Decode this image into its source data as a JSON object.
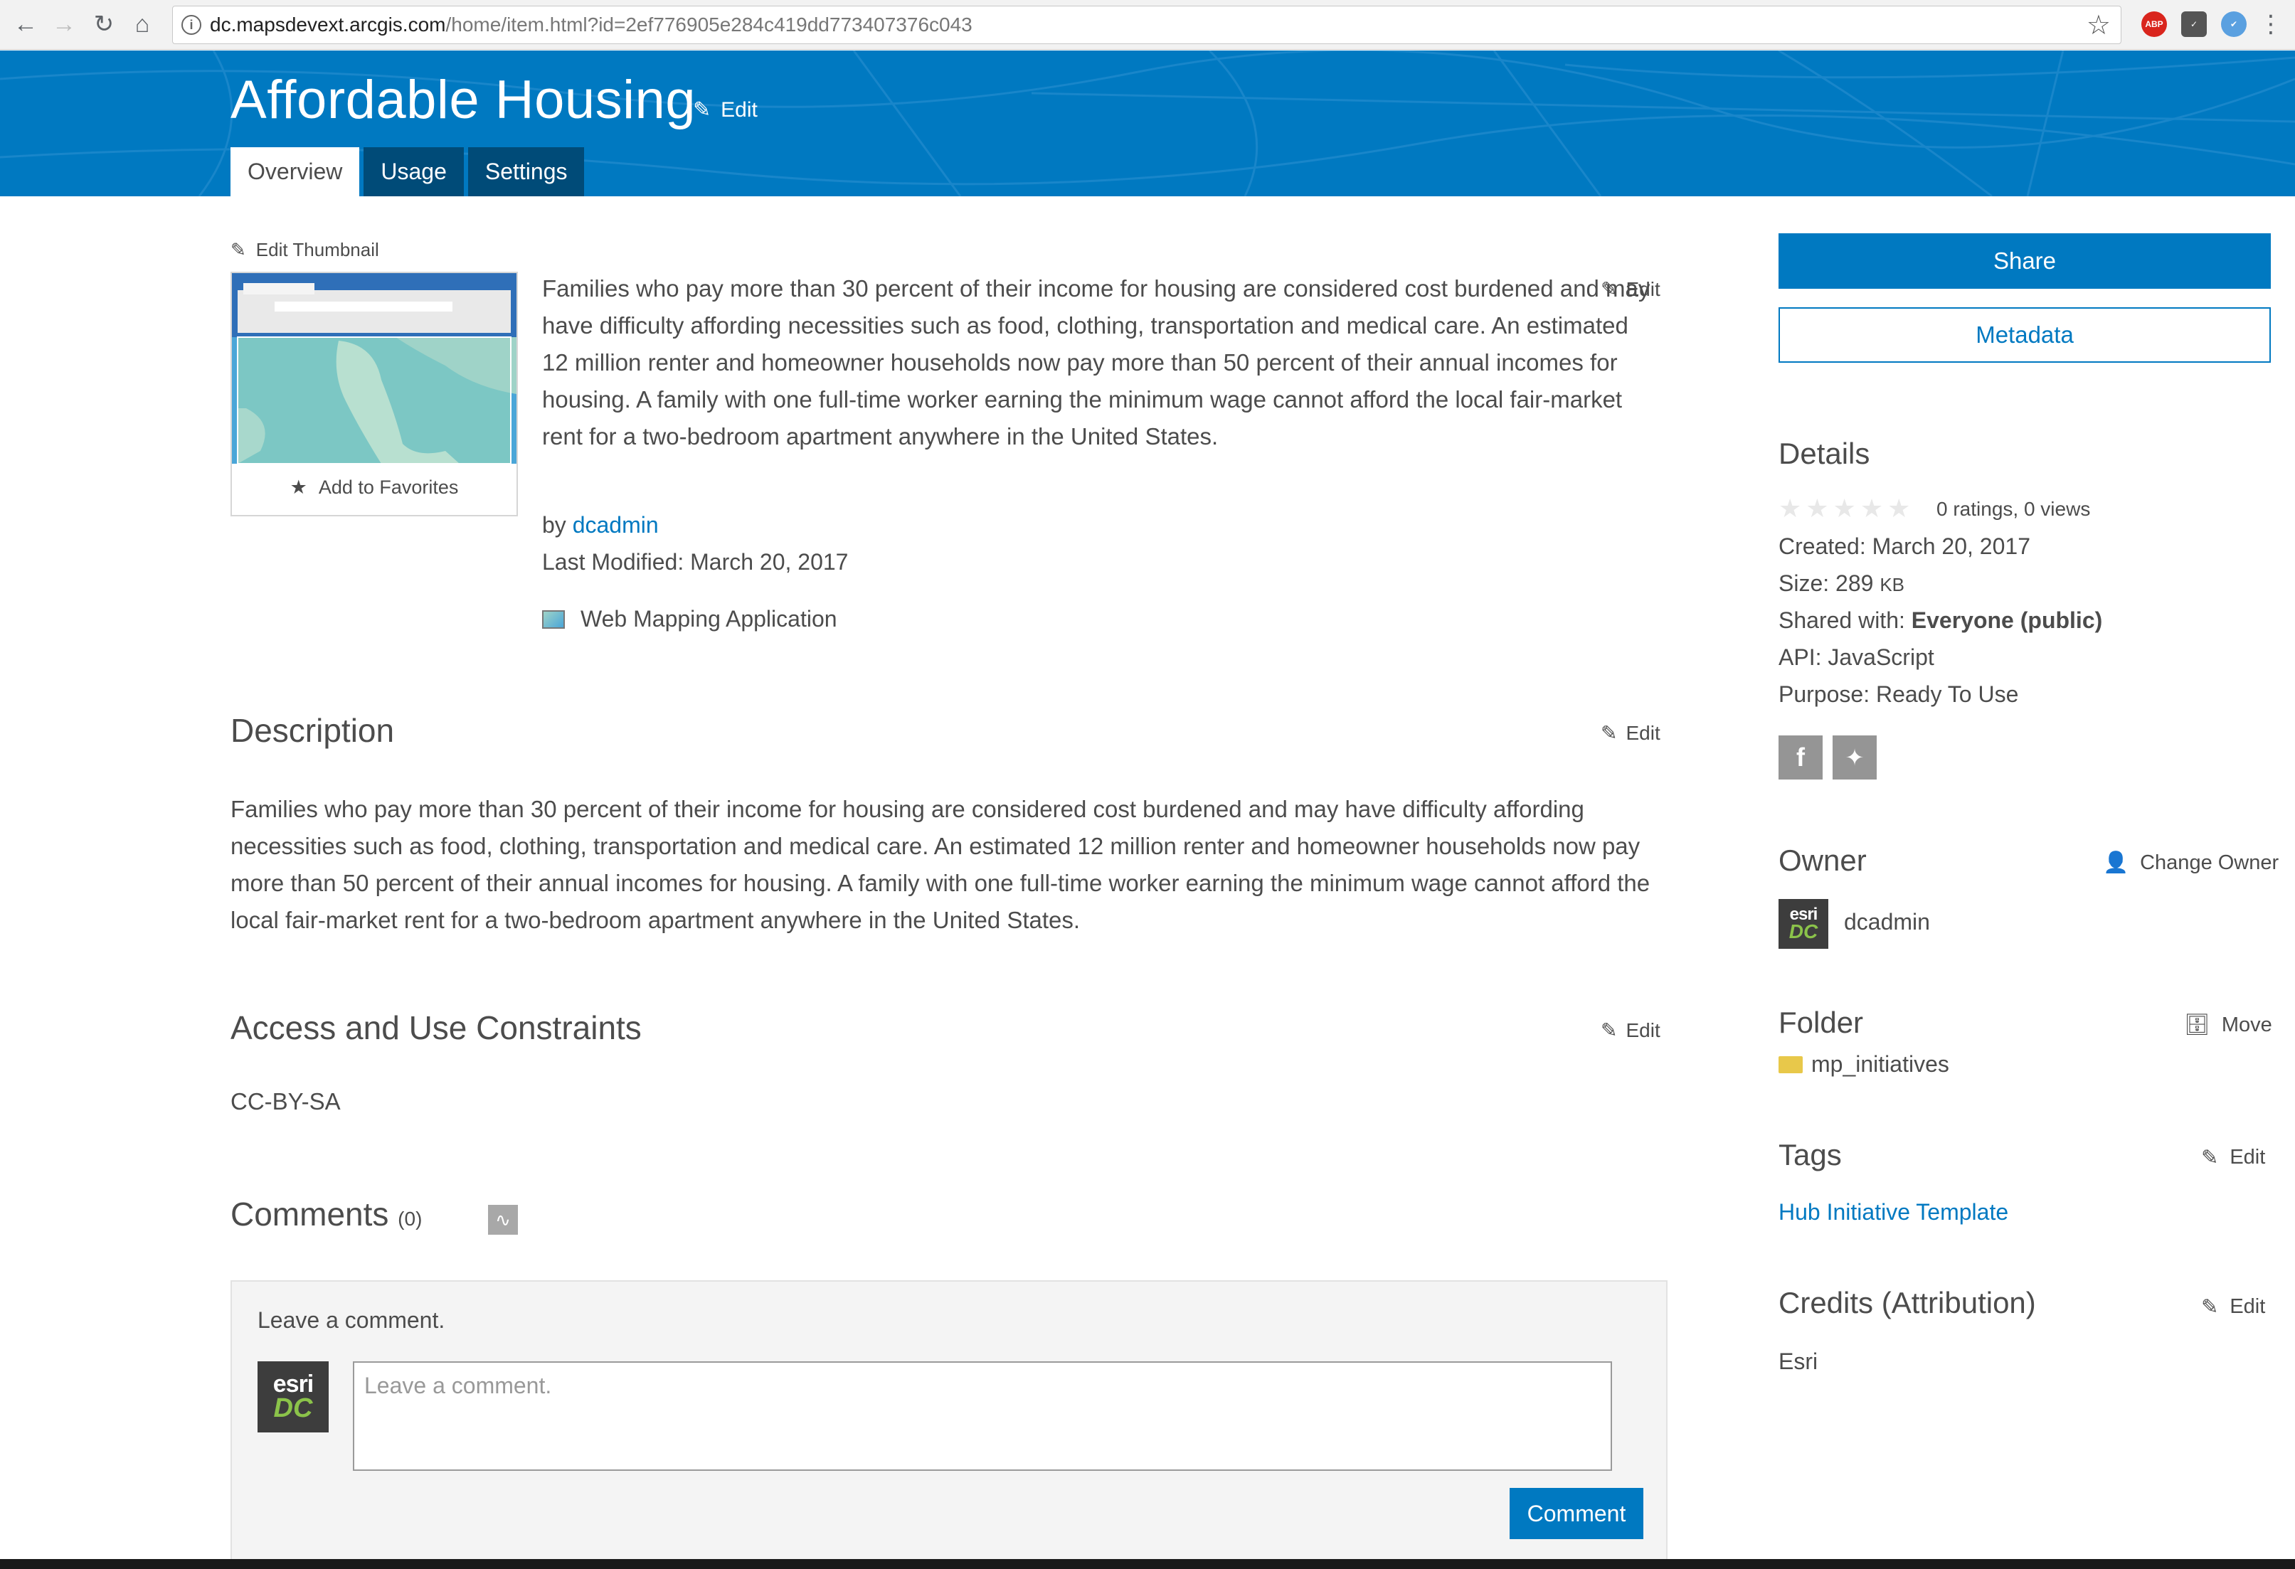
{
  "browser": {
    "url_host": "dc.mapsdevext.arcgis.com",
    "url_path": "/home/item.html?id=2ef776905e284c419dd773407376c043",
    "ext_abp": "ABP"
  },
  "header": {
    "title": "Affordable Housing",
    "edit_label": "Edit",
    "tabs": [
      {
        "label": "Overview",
        "active": true
      },
      {
        "label": "Usage",
        "active": false
      },
      {
        "label": "Settings",
        "active": false
      }
    ]
  },
  "thumbnail": {
    "edit_label": "Edit Thumbnail",
    "favorites_label": "Add to Favorites"
  },
  "summary": {
    "text": "Families who pay more than 30 percent of their income for housing are considered cost burdened and may have difficulty affording necessities such as food, clothing, transportation and medical care. An estimated 12 million renter and homeowner households now pay more than 50 percent of their annual incomes for housing. A family with one full-time worker earning the minimum wage cannot afford the local fair-market rent for a two-bedroom apartment anywhere in the United States.",
    "edit_label": "Edit",
    "by_label": "by",
    "owner": "dcadmin",
    "last_modified": "Last Modified: March 20, 2017",
    "item_type": "Web Mapping Application"
  },
  "description": {
    "title": "Description",
    "edit_label": "Edit",
    "text": "Families who pay more than 30 percent of their income for housing are considered cost burdened and may have difficulty affording necessities such as food, clothing, transportation and medical care. An estimated 12 million renter and homeowner households now pay more than 50 percent of their annual incomes for housing. A family with one full-time worker earning the minimum wage cannot afford the local fair-market rent for a two-bedroom apartment anywhere in the United States."
  },
  "constraints": {
    "title": "Access and Use Constraints",
    "edit_label": "Edit",
    "text": "CC-BY-SA"
  },
  "comments": {
    "title": "Comments",
    "count": "(0)",
    "leave_label": "Leave a comment.",
    "placeholder": "Leave a comment.",
    "button_label": "Comment",
    "avatar_top": "esri",
    "avatar_bottom": "DC"
  },
  "sidebar": {
    "share_label": "Share",
    "metadata_label": "Metadata",
    "details": {
      "title": "Details",
      "ratings": "0 ratings, 0 views",
      "created_label": "Created:",
      "created": "March 20, 2017",
      "size_label": "Size:",
      "size": "289",
      "size_unit": "KB",
      "shared_label": "Shared with:",
      "shared": "Everyone (public)",
      "api_label": "API:",
      "api": "JavaScript",
      "purpose_label": "Purpose:",
      "purpose": "Ready To Use"
    },
    "owner": {
      "title": "Owner",
      "change_label": "Change Owner",
      "name": "dcadmin"
    },
    "folder": {
      "title": "Folder",
      "move_label": "Move",
      "name": "mp_initiatives"
    },
    "tags": {
      "title": "Tags",
      "edit_label": "Edit",
      "items": [
        "Hub Initiative Template"
      ]
    },
    "credits": {
      "title": "Credits (Attribution)",
      "edit_label": "Edit",
      "text": "Esri"
    }
  },
  "colors": {
    "brand_blue": "#0079c1",
    "tab_dark": "#004b78",
    "text": "#4c4c4c"
  }
}
